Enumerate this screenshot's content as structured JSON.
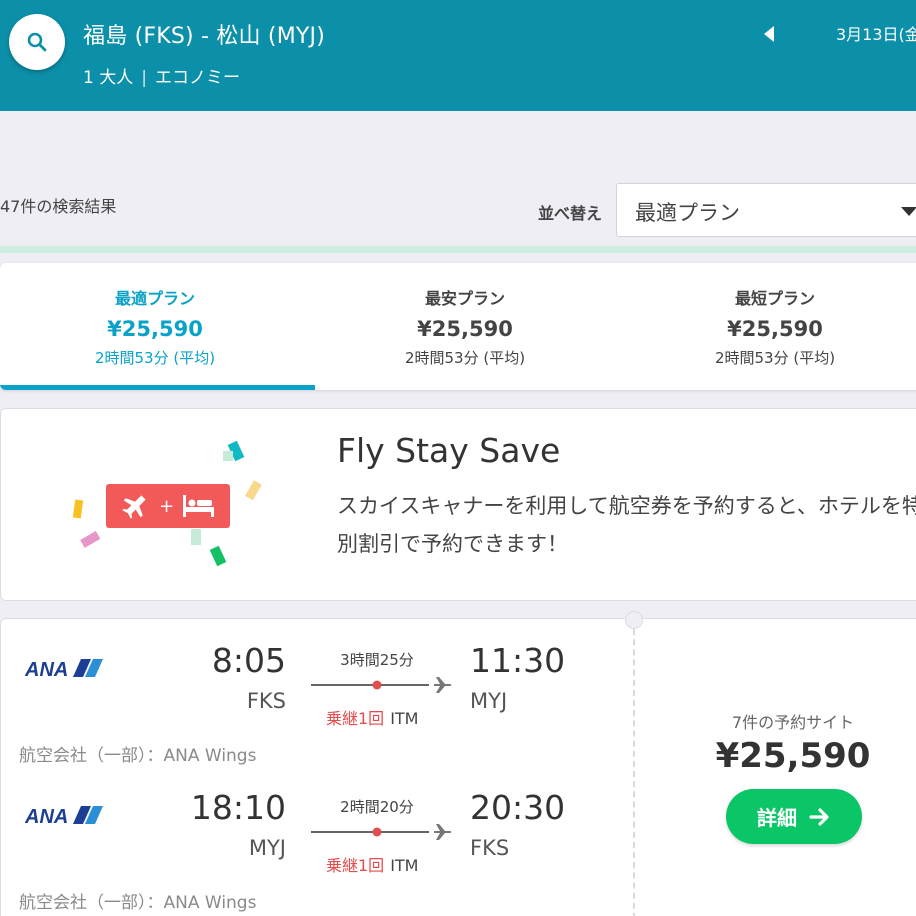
{
  "header": {
    "route": "福島 (FKS) - 松山 (MYJ)",
    "passengers": "1 大人",
    "cabin": "エコノミー",
    "date": "3月13日(金"
  },
  "results": {
    "count_text": "47件の検索結果",
    "sort_label": "並べ替え",
    "sort_value": "最適プラン"
  },
  "tabs": [
    {
      "name": "最適プラン",
      "price": "¥25,590",
      "duration": "2時間53分 (平均)",
      "active": true
    },
    {
      "name": "最安プラン",
      "price": "¥25,590",
      "duration": "2時間53分 (平均)",
      "active": false
    },
    {
      "name": "最短プラン",
      "price": "¥25,590",
      "duration": "2時間53分 (平均)",
      "active": false
    }
  ],
  "promo": {
    "title": "Fly Stay Save",
    "text": "スカイスキャナーを利用して航空券を予約すると、ホテルを特別割引で予約できます！",
    "badge_plus": "+"
  },
  "flight": {
    "legs": [
      {
        "airline_logo": "ANA",
        "dep_time": "8:05",
        "dep_code": "FKS",
        "duration": "3時間25分",
        "stops": "乗継1回",
        "via": "ITM",
        "arr_time": "11:30",
        "arr_code": "MYJ",
        "operated_by": "航空会社（一部）：ANA Wings"
      },
      {
        "airline_logo": "ANA",
        "dep_time": "18:10",
        "dep_code": "MYJ",
        "duration": "2時間20分",
        "stops": "乗継1回",
        "via": "ITM",
        "arr_time": "20:30",
        "arr_code": "FKS",
        "operated_by": "航空会社（一部）：ANA Wings"
      }
    ],
    "sites_text": "7件の予約サイト",
    "price": "¥25,590",
    "detail_label": "詳細"
  },
  "colors": {
    "header_bg": "#0c8fa8",
    "accent": "#0aa2c9",
    "stop_red": "#e24d4d",
    "cta_green": "#0bc666",
    "promo_badge": "#f25a5a",
    "ana_blue": "#1c3f94"
  },
  "icons": {
    "search": "search-icon",
    "prev": "chevron-left-icon",
    "sort_caret": "caret-down-icon",
    "plane": "plane-icon",
    "bed": "bed-icon",
    "arrow": "arrow-right-icon"
  }
}
